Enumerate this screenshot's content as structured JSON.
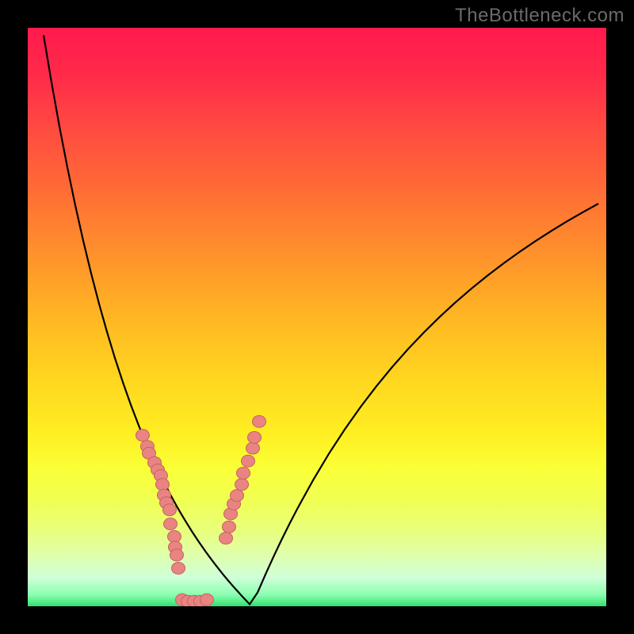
{
  "watermark": "TheBottleneck.com",
  "colors": {
    "frame": "#000000",
    "curve": "#000000",
    "dot_fill": "#e98482",
    "dot_stroke": "#c46260"
  },
  "chart_data": {
    "type": "line",
    "title": "",
    "xlabel": "",
    "ylabel": "",
    "xlim": [
      0,
      100
    ],
    "ylim": [
      0,
      100
    ],
    "note": "Values are percent positions of the curve within the plot area. Curve is a V-shape with minimum near x≈26.9 at y≈0. Axes are unlabeled in source.",
    "series": [
      {
        "name": "bottleneck-curve",
        "x": [
          2.74,
          4.11,
          5.48,
          6.85,
          8.22,
          9.59,
          10.96,
          12.33,
          13.7,
          15.07,
          16.44,
          17.81,
          19.18,
          20.55,
          21.92,
          23.29,
          24.66,
          25.21,
          25.75,
          26.3,
          26.85,
          27.4,
          27.95,
          28.49,
          29.04,
          29.59,
          30.14,
          30.68,
          31.23,
          31.78,
          32.33,
          32.88,
          33.42,
          33.97,
          34.52,
          35.07,
          35.62,
          36.99,
          38.36,
          39.73,
          41.1,
          42.47,
          43.84,
          45.21,
          46.58,
          49.32,
          52.05,
          54.79,
          57.53,
          60.27,
          63.01,
          65.75,
          68.49,
          71.23,
          73.97,
          76.71,
          79.45,
          82.19,
          84.93,
          87.67,
          90.41,
          93.15,
          95.89,
          98.63
        ],
        "y": [
          98.7,
          90.55,
          82.94,
          75.86,
          69.29,
          63.19,
          57.53,
          52.28,
          47.42,
          42.91,
          38.73,
          34.85,
          31.26,
          27.92,
          24.83,
          21.96,
          19.3,
          18.29,
          17.3,
          16.35,
          15.42,
          14.51,
          13.63,
          12.77,
          11.93,
          11.12,
          10.32,
          9.54,
          8.79,
          8.05,
          7.32,
          6.62,
          5.93,
          5.25,
          4.59,
          3.95,
          3.32,
          1.8,
          0.35,
          2.38,
          5.53,
          8.54,
          11.42,
          14.18,
          16.82,
          21.79,
          26.36,
          30.57,
          34.45,
          38.04,
          41.37,
          44.47,
          47.35,
          50.04,
          52.56,
          54.92,
          57.14,
          59.23,
          61.2,
          63.06,
          64.82,
          66.49,
          68.08,
          69.59
        ]
      }
    ],
    "dots": [
      {
        "name": "left-cluster",
        "points": [
          {
            "x": 19.86,
            "y": 29.55
          },
          {
            "x": 20.68,
            "y": 27.64
          },
          {
            "x": 20.96,
            "y": 26.45
          },
          {
            "x": 21.92,
            "y": 24.83
          },
          {
            "x": 22.47,
            "y": 23.57
          },
          {
            "x": 23.01,
            "y": 22.59
          },
          {
            "x": 23.29,
            "y": 21.06
          },
          {
            "x": 23.56,
            "y": 19.21
          },
          {
            "x": 23.97,
            "y": 17.89
          },
          {
            "x": 24.52,
            "y": 16.66
          },
          {
            "x": 24.66,
            "y": 14.23
          },
          {
            "x": 25.34,
            "y": 12.05
          },
          {
            "x": 25.48,
            "y": 10.21
          },
          {
            "x": 25.75,
            "y": 8.85
          },
          {
            "x": 26.03,
            "y": 6.58
          }
        ]
      },
      {
        "name": "bottom-cluster",
        "points": [
          {
            "x": 26.71,
            "y": 1.13
          },
          {
            "x": 27.67,
            "y": 0.85
          },
          {
            "x": 28.77,
            "y": 0.85
          },
          {
            "x": 29.86,
            "y": 0.85
          },
          {
            "x": 30.96,
            "y": 1.13
          }
        ]
      },
      {
        "name": "right-cluster",
        "points": [
          {
            "x": 34.25,
            "y": 11.77
          },
          {
            "x": 34.79,
            "y": 13.72
          },
          {
            "x": 35.07,
            "y": 15.96
          },
          {
            "x": 35.62,
            "y": 17.68
          },
          {
            "x": 36.16,
            "y": 19.15
          },
          {
            "x": 36.99,
            "y": 21.06
          },
          {
            "x": 37.26,
            "y": 23.02
          },
          {
            "x": 38.08,
            "y": 25.11
          },
          {
            "x": 38.9,
            "y": 27.32
          },
          {
            "x": 39.18,
            "y": 29.18
          },
          {
            "x": 40.0,
            "y": 31.94
          }
        ]
      }
    ]
  }
}
